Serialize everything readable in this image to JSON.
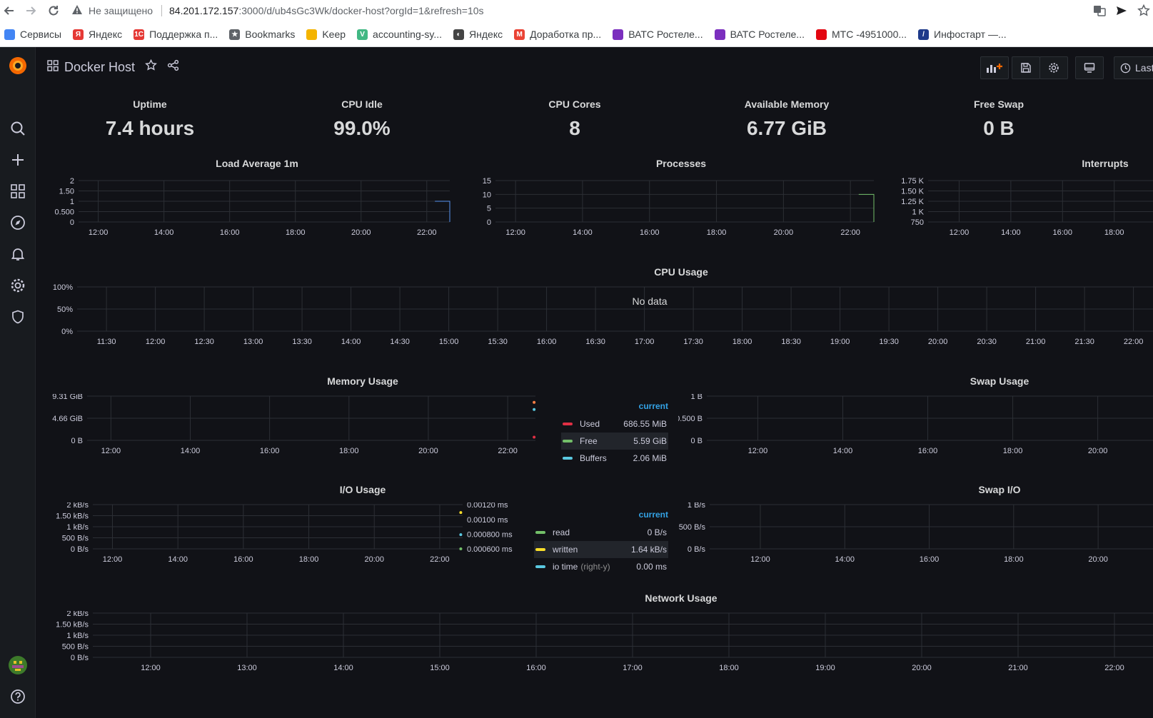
{
  "browser": {
    "security_label": "Не защищено",
    "url_host": "84.201.172.157",
    "url_rest": ":3000/d/ub4sGc3Wk/docker-host?orgId=1&refresh=10s",
    "bookmarks": [
      {
        "label": "Сервисы",
        "color": "#4285f4",
        "glyph": ""
      },
      {
        "label": "Яндекс",
        "color": "#e53935",
        "glyph": "Я"
      },
      {
        "label": "Поддержка п...",
        "color": "#e53935",
        "glyph": "1С"
      },
      {
        "label": "Bookmarks",
        "color": "#5f6368",
        "glyph": "★"
      },
      {
        "label": "Keep",
        "color": "#f4b400",
        "glyph": ""
      },
      {
        "label": "accounting-sy...",
        "color": "#41b883",
        "glyph": "V"
      },
      {
        "label": "Яндекс",
        "color": "#444",
        "glyph": "◐"
      },
      {
        "label": "Доработка пр...",
        "color": "#ea4335",
        "glyph": "M"
      },
      {
        "label": "ВАТС Ростеле...",
        "color": "#7b2fbe",
        "glyph": ""
      },
      {
        "label": "ВАТС Ростеле...",
        "color": "#7b2fbe",
        "glyph": ""
      },
      {
        "label": "МТС -4951000...",
        "color": "#e30611",
        "glyph": ""
      },
      {
        "label": "Инфостарт —...",
        "color": "#1e3a8a",
        "glyph": "/"
      }
    ]
  },
  "dashboard": {
    "title": "Docker Host",
    "time_label": "Last"
  },
  "stats": [
    {
      "title": "Uptime",
      "value": "7.4 hours"
    },
    {
      "title": "CPU Idle",
      "value": "99.0%"
    },
    {
      "title": "CPU Cores",
      "value": "8"
    },
    {
      "title": "Available Memory",
      "value": "6.77 GiB"
    },
    {
      "title": "Free Swap",
      "value": "0 B"
    }
  ],
  "panels": {
    "load": {
      "title": "Load Average 1m"
    },
    "processes": {
      "title": "Processes"
    },
    "interrupts": {
      "title": "Interrupts"
    },
    "cpu": {
      "title": "CPU Usage",
      "no_data": "No data"
    },
    "memory": {
      "title": "Memory Usage",
      "legend_header": "current"
    },
    "swap": {
      "title": "Swap Usage"
    },
    "io": {
      "title": "I/O Usage",
      "legend_header": "current",
      "right_y_note": "(right-y)"
    },
    "swapio": {
      "title": "Swap I/O"
    },
    "network": {
      "title": "Network Usage"
    }
  },
  "chart_data": [
    {
      "id": "load",
      "type": "line",
      "title": "Load Average 1m",
      "yticks": [
        "0",
        "0.500",
        "1",
        "1.50",
        "2"
      ],
      "ylim": [
        0,
        2
      ],
      "xticks": [
        "12:00",
        "14:00",
        "16:00",
        "18:00",
        "20:00",
        "22:00"
      ],
      "series": [
        {
          "values": [
            [
              0.96,
              1.0
            ],
            [
              0.96,
              0.0
            ]
          ],
          "color": "#5794f2"
        }
      ]
    },
    {
      "id": "processes",
      "type": "line",
      "title": "Processes",
      "yticks": [
        "0",
        "5",
        "10",
        "15"
      ],
      "ylim": [
        0,
        15
      ],
      "xticks": [
        "12:00",
        "14:00",
        "16:00",
        "18:00",
        "20:00",
        "22:00"
      ],
      "series": [
        {
          "values": [
            [
              0.96,
              10
            ],
            [
              0.96,
              0
            ]
          ],
          "color": "#73bf69"
        }
      ]
    },
    {
      "id": "interrupts",
      "type": "line",
      "title": "Interrupts",
      "yticks": [
        "750",
        "1 K",
        "1.25 K",
        "1.50 K",
        "1.75 K"
      ],
      "ylim": [
        750,
        1750
      ],
      "xticks": [
        "12:00",
        "14:00",
        "16:00",
        "18:00"
      ],
      "series": []
    },
    {
      "id": "cpu",
      "type": "line",
      "title": "CPU Usage",
      "yticks": [
        "0%",
        "50%",
        "100%"
      ],
      "ylim": [
        0,
        100
      ],
      "xticks": [
        "11:30",
        "12:00",
        "12:30",
        "13:00",
        "13:30",
        "14:00",
        "14:30",
        "15:00",
        "15:30",
        "16:00",
        "16:30",
        "17:00",
        "17:30",
        "18:00",
        "18:30",
        "19:00",
        "19:30",
        "20:00",
        "20:30",
        "21:00",
        "21:30",
        "22:00"
      ],
      "series": []
    },
    {
      "id": "memory",
      "type": "line",
      "title": "Memory Usage",
      "yticks": [
        "0 B",
        "4.66 GiB",
        "9.31 GiB"
      ],
      "ylim": [
        0,
        9.31
      ],
      "xticks": [
        "12:00",
        "14:00",
        "16:00",
        "18:00",
        "20:00",
        "22:00"
      ],
      "series": [
        {
          "name": "Used",
          "current": "686.55 MiB",
          "color": "#e02f44",
          "points": [
            [
              0.997,
              0.67
            ]
          ]
        },
        {
          "name": "Free",
          "current": "5.59 GiB",
          "color": "#73bf69",
          "points": []
        },
        {
          "name": "Buffers",
          "current": "2.06 MiB",
          "color": "#5ac8e0",
          "points": [
            [
              0.997,
              6.5
            ]
          ]
        },
        {
          "name": "",
          "current": "",
          "color": "#ff7f45",
          "points": [
            [
              0.997,
              8.0
            ]
          ]
        }
      ]
    },
    {
      "id": "swap",
      "type": "line",
      "title": "Swap Usage",
      "yticks": [
        "0 B",
        "0.500 B",
        "1 B"
      ],
      "ylim": [
        0,
        1
      ],
      "xticks": [
        "12:00",
        "14:00",
        "16:00",
        "18:00",
        "20:00"
      ],
      "series": []
    },
    {
      "id": "io",
      "type": "line",
      "title": "I/O Usage",
      "yticks": [
        "0 B/s",
        "500 B/s",
        "1 kB/s",
        "1.50 kB/s",
        "2 kB/s"
      ],
      "ylim": [
        0,
        2
      ],
      "yticks_right": [
        "0.000600 ms",
        "0.000800 ms",
        "0.00100 ms",
        "0.00120 ms"
      ],
      "xticks": [
        "12:00",
        "14:00",
        "16:00",
        "18:00",
        "20:00",
        "22:00"
      ],
      "series": [
        {
          "name": "read",
          "current": "0 B/s",
          "color": "#73bf69",
          "points": [
            [
              0.995,
              0.0
            ]
          ]
        },
        {
          "name": "written",
          "current": "1.64 kB/s",
          "color": "#fade2a",
          "points": [
            [
              0.995,
              1.64
            ]
          ]
        },
        {
          "name": "io time",
          "current": "0.00 ms",
          "color": "#5ac8e0",
          "points": [
            [
              0.995,
              0.64
            ]
          ]
        }
      ]
    },
    {
      "id": "swapio",
      "type": "line",
      "title": "Swap I/O",
      "yticks": [
        "0 B/s",
        "0.500 B/s",
        "1 B/s"
      ],
      "ylim": [
        0,
        1
      ],
      "xticks": [
        "12:00",
        "14:00",
        "16:00",
        "18:00",
        "20:00"
      ],
      "series": []
    },
    {
      "id": "network",
      "type": "line",
      "title": "Network Usage",
      "yticks": [
        "0 B/s",
        "500 B/s",
        "1 kB/s",
        "1.50 kB/s",
        "2 kB/s"
      ],
      "ylim": [
        0,
        2
      ],
      "xticks": [
        "12:00",
        "13:00",
        "14:00",
        "15:00",
        "16:00",
        "17:00",
        "18:00",
        "19:00",
        "20:00",
        "21:00",
        "22:00"
      ],
      "series": []
    }
  ]
}
